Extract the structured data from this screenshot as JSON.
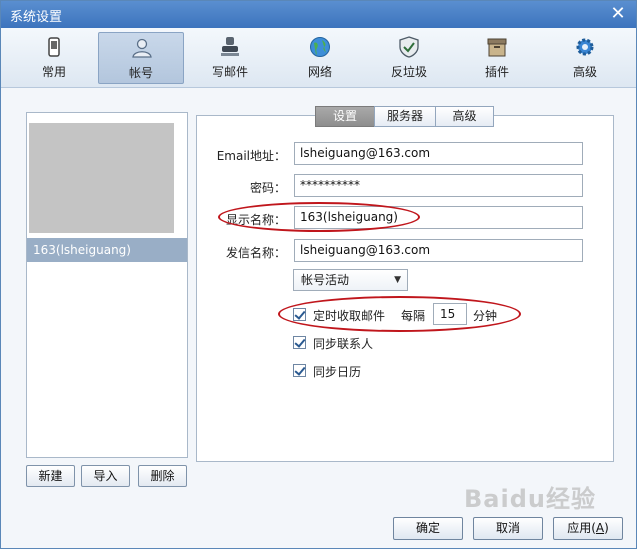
{
  "window": {
    "title": "系统设置",
    "close_glyph": "✕"
  },
  "toolbar": {
    "items": [
      {
        "label": "常用",
        "icon": "phone-icon"
      },
      {
        "label": "帐号",
        "icon": "user-icon"
      },
      {
        "label": "写邮件",
        "icon": "stamp-icon"
      },
      {
        "label": "网络",
        "icon": "globe-icon"
      },
      {
        "label": "反垃圾",
        "icon": "shield-icon"
      },
      {
        "label": "插件",
        "icon": "box-icon"
      },
      {
        "label": "高级",
        "icon": "gear-icon"
      }
    ],
    "active_index": 1
  },
  "accounts": {
    "items": [
      {
        "label": "163(lsheiguang)"
      }
    ],
    "buttons": {
      "new": "新建",
      "import": "导入",
      "delete": "删除"
    }
  },
  "tabs": [
    {
      "label": "设置",
      "active": true
    },
    {
      "label": "服务器",
      "active": false
    },
    {
      "label": "高级",
      "active": false
    }
  ],
  "form": {
    "email_label": "Email地址：",
    "email_value": "lsheiguang@163.com",
    "password_label": "密码：",
    "password_value": "**********",
    "display_label": "显示名称：",
    "display_value": "163(lsheiguang)",
    "sender_label": "发信名称：",
    "sender_value": "lsheiguang@163.com",
    "status_select": "帐号活动",
    "fetch_label": "定时收取邮件",
    "interval_prefix": "每隔",
    "interval_value": "15",
    "interval_unit": "分钟",
    "sync_contacts": "同步联系人",
    "sync_calendar": "同步日历"
  },
  "footer": {
    "ok": "确定",
    "cancel": "取消",
    "apply": "应用",
    "apply_key": "A"
  },
  "watermark": "Baidu经验",
  "colors": {
    "title_bar": "#3c74bd",
    "selection": "#99aec6",
    "highlight_ring": "#c0161c",
    "active_tab": "#8e8e8e"
  }
}
